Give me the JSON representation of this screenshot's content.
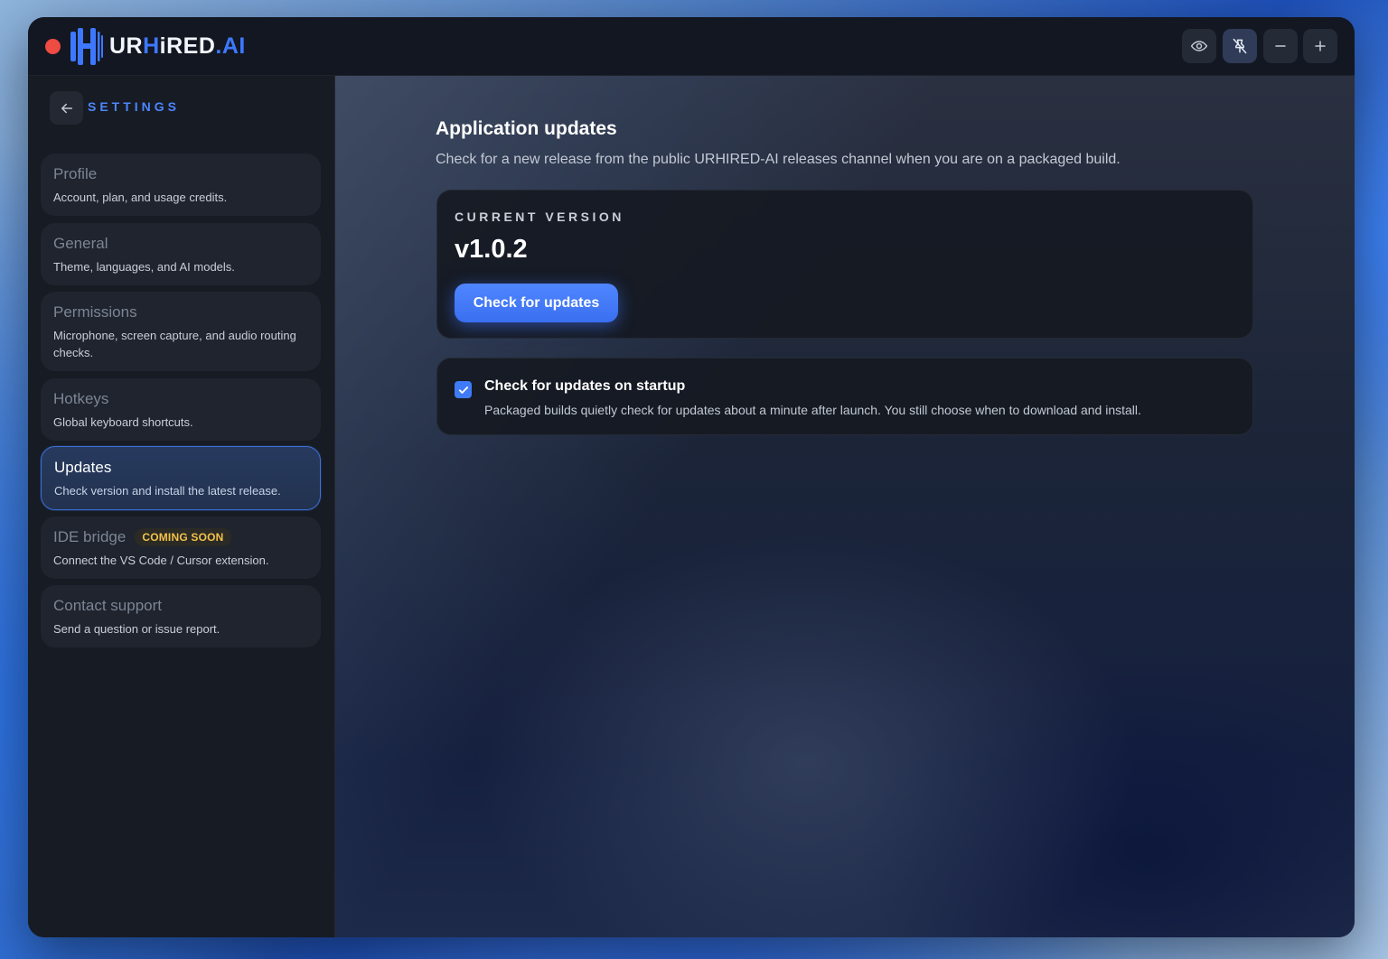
{
  "app": {
    "logo_prefix": "UR",
    "logo_h": "H",
    "logo_middle": "iRED",
    "logo_suffix": ".AI"
  },
  "titlebar": {
    "buttons": [
      {
        "icon": "eye-icon"
      },
      {
        "icon": "pin-off-icon",
        "active": true
      },
      {
        "icon": "minus-icon"
      },
      {
        "icon": "plus-icon"
      }
    ]
  },
  "sidebar": {
    "back_icon": "arrow-left-icon",
    "heading": "SETTINGS",
    "items": [
      {
        "title": "Profile",
        "desc": "Account, plan, and usage credits."
      },
      {
        "title": "General",
        "desc": "Theme, languages, and AI models."
      },
      {
        "title": "Permissions",
        "desc": "Microphone, screen capture, and audio routing checks."
      },
      {
        "title": "Hotkeys",
        "desc": "Global keyboard shortcuts."
      },
      {
        "title": "Updates",
        "desc": "Check version and install the latest release.",
        "active": true
      },
      {
        "title": "IDE bridge",
        "badge": "COMING SOON",
        "desc": "Connect the VS Code / Cursor extension."
      },
      {
        "title": "Contact support",
        "desc": "Send a question or issue report."
      }
    ]
  },
  "main": {
    "title": "Application updates",
    "subtitle": "Check for a new release from the public URHIRED-AI releases channel when you are on a packaged build.",
    "version_card": {
      "label": "CURRENT VERSION",
      "version": "v1.0.2",
      "button": "Check for updates"
    },
    "startup_card": {
      "checked": true,
      "title": "Check for updates on startup",
      "desc": "Packaged builds quietly check for updates about a minute after launch. You still choose when to download and install."
    }
  },
  "colors": {
    "accent": "#3d78ff",
    "close": "#ee4b42",
    "badge": "#f2c24a"
  }
}
